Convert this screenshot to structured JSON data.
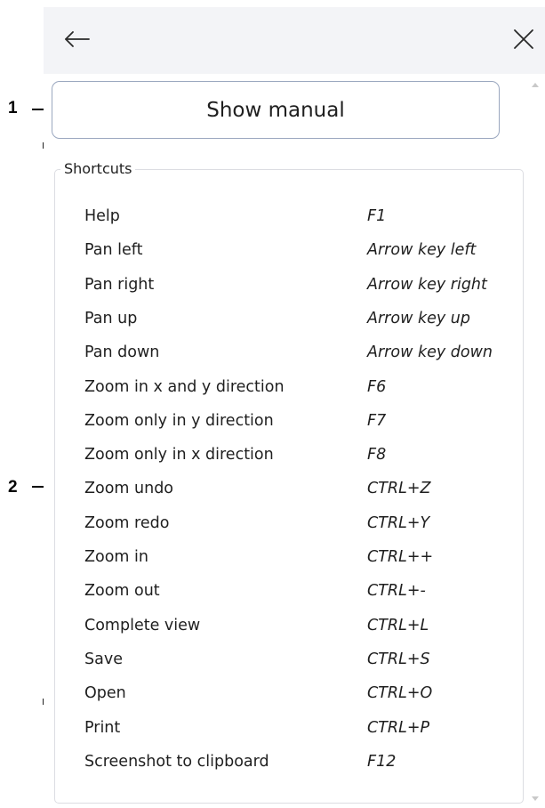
{
  "annotations": {
    "callout_1": "1",
    "callout_2": "2"
  },
  "header": {
    "back_icon": "arrow-left-icon",
    "back_glyph": "←",
    "close_icon": "close-icon",
    "close_glyph": "✕"
  },
  "manual_button": {
    "label": "Show manual"
  },
  "shortcuts": {
    "legend": "Shortcuts",
    "items": [
      {
        "label": "Help",
        "key": "F1"
      },
      {
        "label": "Pan left",
        "key": "Arrow key left"
      },
      {
        "label": "Pan right",
        "key": "Arrow key right"
      },
      {
        "label": "Pan up",
        "key": "Arrow key up"
      },
      {
        "label": "Pan down",
        "key": "Arrow key down"
      },
      {
        "label": "Zoom in x and y direction",
        "key": "F6"
      },
      {
        "label": "Zoom only in y direction",
        "key": "F7"
      },
      {
        "label": "Zoom only in x direction",
        "key": "F8"
      },
      {
        "label": "Zoom undo",
        "key": "CTRL+Z"
      },
      {
        "label": "Zoom redo",
        "key": "CTRL+Y"
      },
      {
        "label": "Zoom in",
        "key": "CTRL++"
      },
      {
        "label": "Zoom out",
        "key": "CTRL+-"
      },
      {
        "label": "Complete view",
        "key": "CTRL+L"
      },
      {
        "label": "Save",
        "key": "CTRL+S"
      },
      {
        "label": "Open",
        "key": "CTRL+O"
      },
      {
        "label": "Print",
        "key": "CTRL+P"
      },
      {
        "label": "Screenshot to clipboard",
        "key": "F12"
      }
    ]
  },
  "colors": {
    "panel_background": "#f3f4f7",
    "button_border": "#9aa7bf",
    "group_border": "#dcdde2",
    "text": "#1f1f1f"
  }
}
